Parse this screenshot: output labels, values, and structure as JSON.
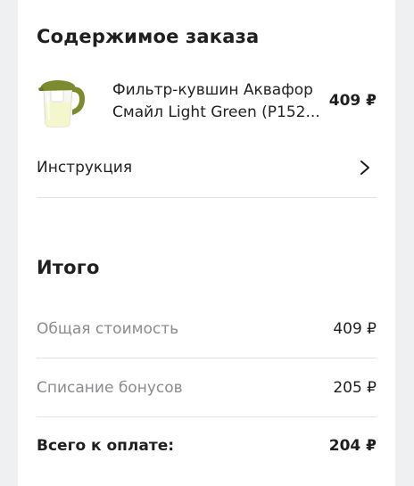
{
  "order": {
    "title": "Содержимое заказа",
    "product": {
      "name": "Фильтр-кувшин Аквафор Смайл Light Green (P152...",
      "price": "409 ₽",
      "image_icon": "water-filter-pitcher-icon"
    },
    "instruction": {
      "label": "Инструкция",
      "icon": "chevron-right-icon"
    }
  },
  "summary": {
    "title": "Итого",
    "rows": [
      {
        "label": "Общая стоимость",
        "value": "409 ₽"
      },
      {
        "label": "Списание бонусов",
        "value": "205 ₽"
      },
      {
        "label": "Всего к оплате:",
        "value": "204 ₽"
      }
    ]
  },
  "colors": {
    "background": "#eef0f2",
    "card": "#ffffff",
    "muted_text": "#8a8c90",
    "divider": "#e2e3e6",
    "pitcher_green": "#7d8a2e"
  }
}
